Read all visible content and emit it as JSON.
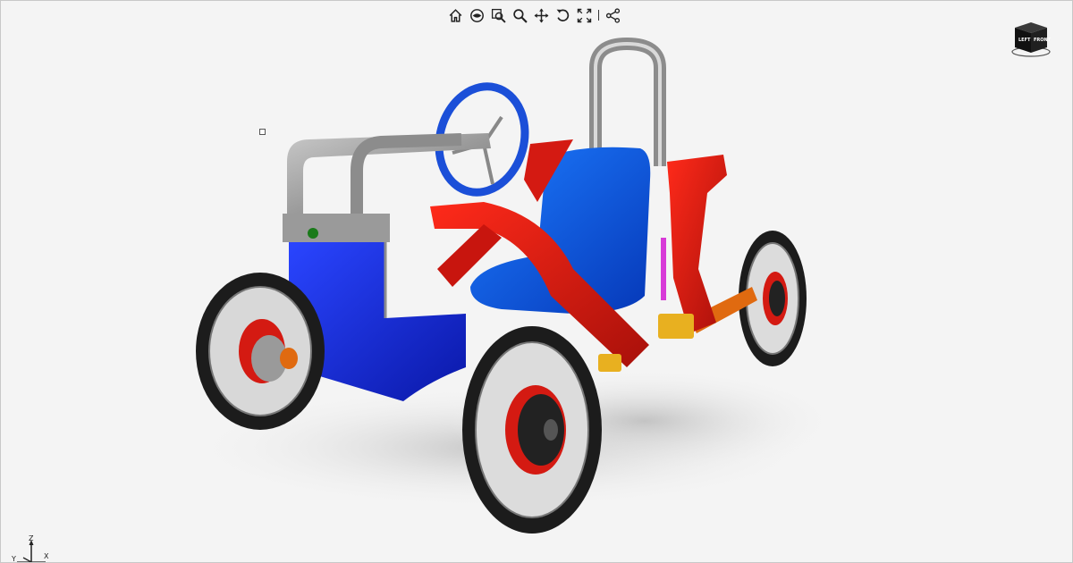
{
  "toolbar": {
    "buttons": [
      {
        "icon": "home-icon"
      },
      {
        "icon": "view-mode-icon"
      },
      {
        "icon": "zoom-window-icon"
      },
      {
        "icon": "zoom-icon"
      },
      {
        "icon": "pan-icon"
      },
      {
        "icon": "rotate-icon"
      },
      {
        "icon": "fit-screen-icon"
      },
      {
        "icon": "share-icon"
      }
    ]
  },
  "navcube": {
    "faces": {
      "left": "LEFT",
      "front": "FRONT"
    }
  },
  "triad": {
    "z": "Z",
    "y": "Y",
    "x": "X"
  },
  "colors": {
    "background": "#f4f4f4",
    "body_blue": "#1a2ee0",
    "seat_blue": "#0d5de8",
    "frame_red": "#d41a12",
    "frame_grey": "#8c8c8c",
    "tire_black": "#1c1c1c",
    "hub_orange": "#e06a10"
  }
}
